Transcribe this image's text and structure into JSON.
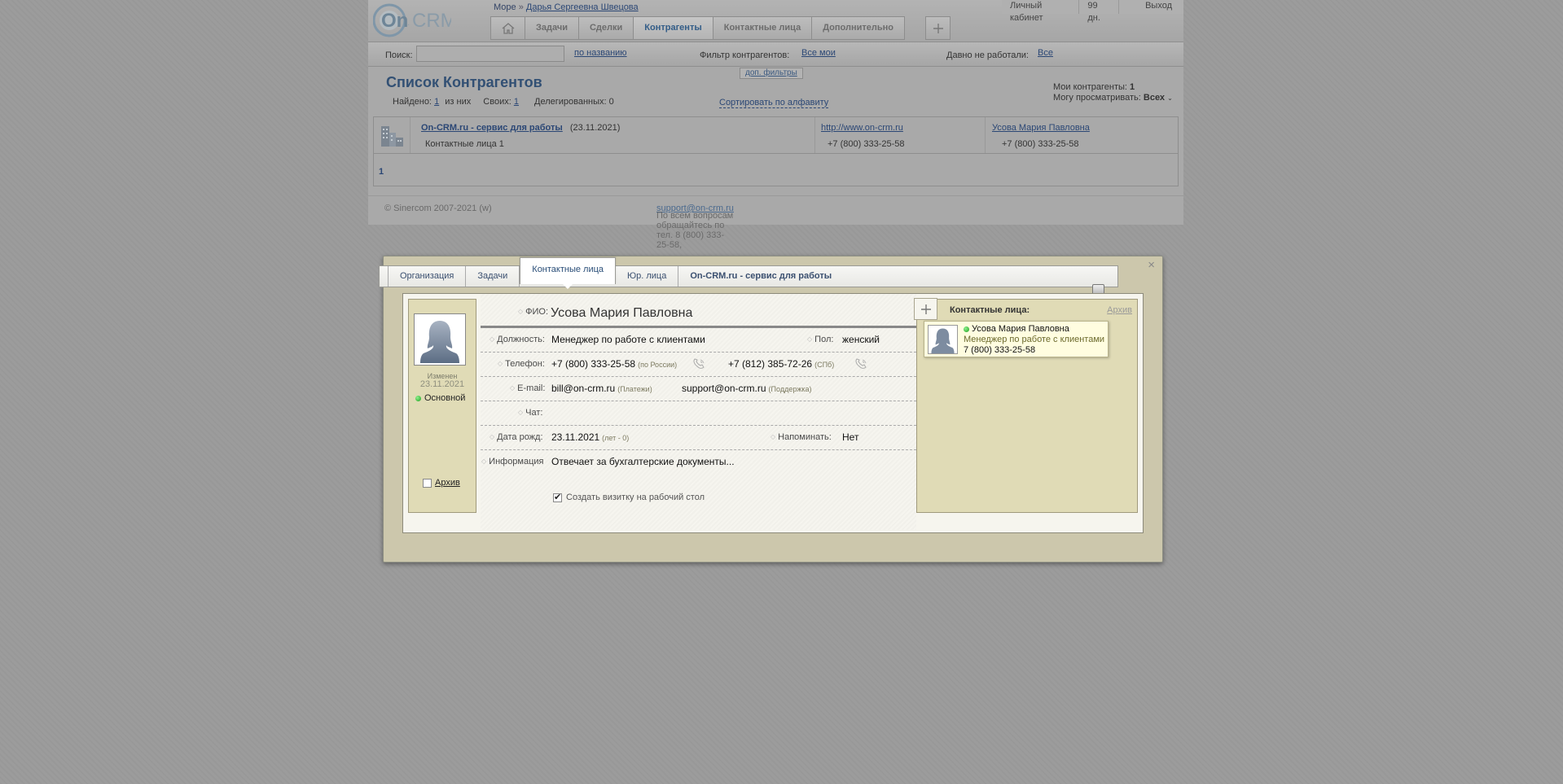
{
  "header": {
    "logo_text": "On·CRM",
    "breadcrumb": {
      "root": "Море",
      "separator": "»",
      "user": "Дарья Сергеевна Швецова"
    },
    "nav": [
      {
        "label": "Задачи"
      },
      {
        "label": "Сделки"
      },
      {
        "label": "Контрагенты",
        "active": true
      },
      {
        "label": "Контактные лица"
      },
      {
        "label": "Дополнительно"
      }
    ],
    "top_right": {
      "cabinet": "Личный кабинет",
      "days": "99 дн.",
      "logout": "Выход"
    }
  },
  "searchbar": {
    "search_label": "Поиск:",
    "search_value": "",
    "search_by": "по названию",
    "filter_label": "Фильтр контрагентов:",
    "filter_value": "Все мои",
    "inactive_label": "Давно не работали:",
    "inactive_value": "Все",
    "extra_filters": "доп. фильтры"
  },
  "list": {
    "title": "Список Контрагентов",
    "found_label": "Найдено:",
    "found_value": "1",
    "of_them": "из них",
    "own_label": "Своих:",
    "own_value": "1",
    "delegated": "Делегированных: 0",
    "sort_link": "Сортировать по алфавиту",
    "my_counterparts_label": "Мои контрагенты:",
    "my_counterparts_value": "1",
    "can_view_label": "Могу просматривать:",
    "can_view_value": "Всех",
    "rows": [
      {
        "name": "On-CRM.ru - сервис для работы",
        "date": "(23.11.2021)",
        "contacts": "Контактные лица 1",
        "site": "http://www.on-crm.ru",
        "site_phone": "+7 (800) 333-25-58",
        "manager": "Усова Мария Павловна",
        "manager_phone": "+7 (800) 333-25-58"
      }
    ],
    "page": "1"
  },
  "footer": {
    "copyright": "© Sinercom 2007-2021 (w)",
    "contact_text": "По всем вопросам обращайтесь по тел. 8 (800) 333-25-58,",
    "email": "support@on-crm.ru"
  },
  "modal": {
    "tabs": [
      {
        "label": "Организация"
      },
      {
        "label": "Задачи"
      },
      {
        "label": "Контактные лица",
        "active": true
      },
      {
        "label": "Юр. лица"
      }
    ],
    "org_name": "On-CRM.ru - сервис для работы",
    "close": "×",
    "left": {
      "changed_label": "Изменен",
      "changed_date": "23.11.2021",
      "main_label": "Основной",
      "archive_label": "Архив",
      "archive_checked": false
    },
    "form": {
      "fio_label": "ФИО:",
      "fio_value": "Усова Мария Павловна",
      "position_label": "Должность:",
      "position_value": "Менеджер по работе с клиентами",
      "gender_label": "Пол:",
      "gender_value": "женский",
      "phone_label": "Телефон:",
      "phone1": "+7 (800) 333-25-58",
      "phone1_note": "(по России)",
      "phone2": "+7 (812) 385-72-26",
      "phone2_note": "(СПб)",
      "email_label": "E-mail:",
      "email1": "bill@on-crm.ru",
      "email1_note": "(Платежи)",
      "email2": "support@on-crm.ru",
      "email2_note": "(Поддержка)",
      "chat_label": "Чат:",
      "chat_value": "",
      "birth_label": "Дата рожд:",
      "birth_value": "23.11.2021",
      "birth_note": "(лет - 0)",
      "remind_label": "Напоминать:",
      "remind_value": "Нет",
      "info_label": "Информация",
      "info_value": "Отвечает за бухгалтерские документы...",
      "card_label": "Создать визитку на рабочий стол",
      "card_checked": true
    },
    "right": {
      "title": "Контактные лица:",
      "archive_link": "Архив",
      "contacts": [
        {
          "name": "Усова Мария Павловна",
          "position": "Менеджер по работе с клиентами",
          "phone": "7 (800) 333-25-58"
        }
      ]
    }
  },
  "colors": {
    "accent": "#325074",
    "link": "#2b4775",
    "panel": "#e0dbb6",
    "status_online": "#1c9d1c"
  }
}
